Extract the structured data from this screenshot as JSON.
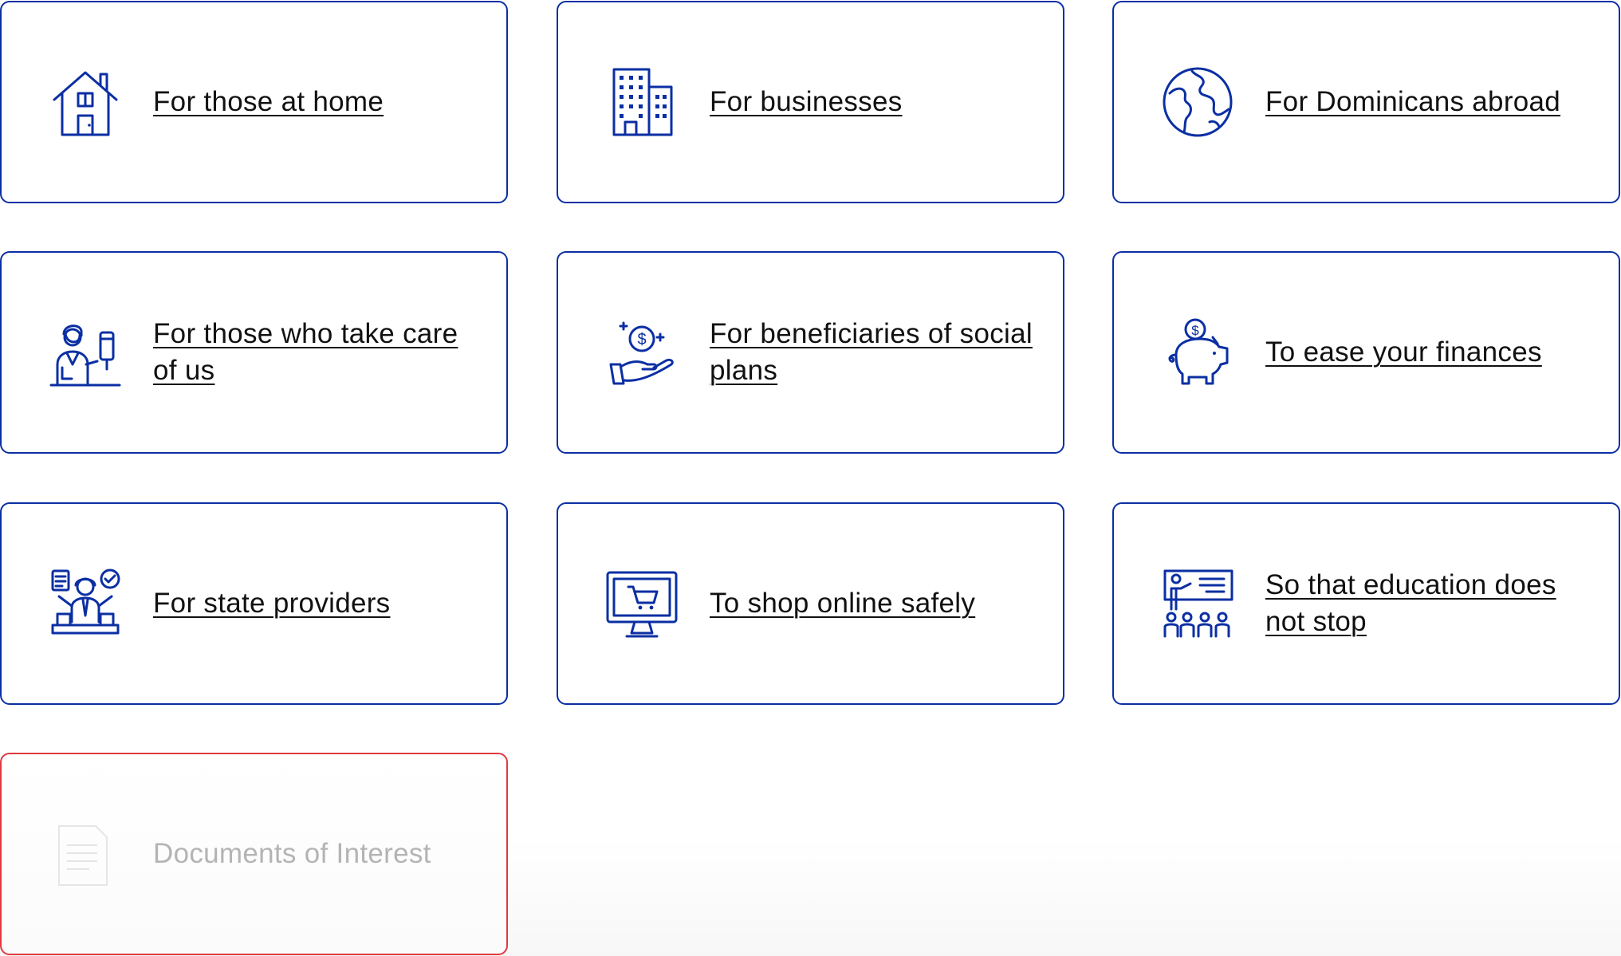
{
  "cards": [
    {
      "label": "For those at home",
      "icon": "house-icon"
    },
    {
      "label": "For businesses",
      "icon": "office-building-icon"
    },
    {
      "label": "For Dominicans abroad",
      "icon": "globe-icon"
    },
    {
      "label": "For those who take care of us",
      "icon": "healthcare-worker-icon"
    },
    {
      "label": "For beneficiaries of social plans",
      "icon": "hand-coin-icon"
    },
    {
      "label": "To ease your finances",
      "icon": "piggy-bank-icon"
    },
    {
      "label": "For state providers",
      "icon": "provider-icon"
    },
    {
      "label": "To shop online safely",
      "icon": "monitor-cart-icon"
    },
    {
      "label": "So that education does not stop",
      "icon": "teacher-class-icon"
    },
    {
      "label": "Documents of Interest",
      "icon": "document-icon"
    }
  ],
  "colors": {
    "card_border": "#0b2fa3",
    "icon": "#0b2fa3",
    "highlight_border": "#e03a3e",
    "muted_text": "#b4b4b4",
    "text": "#111111"
  }
}
